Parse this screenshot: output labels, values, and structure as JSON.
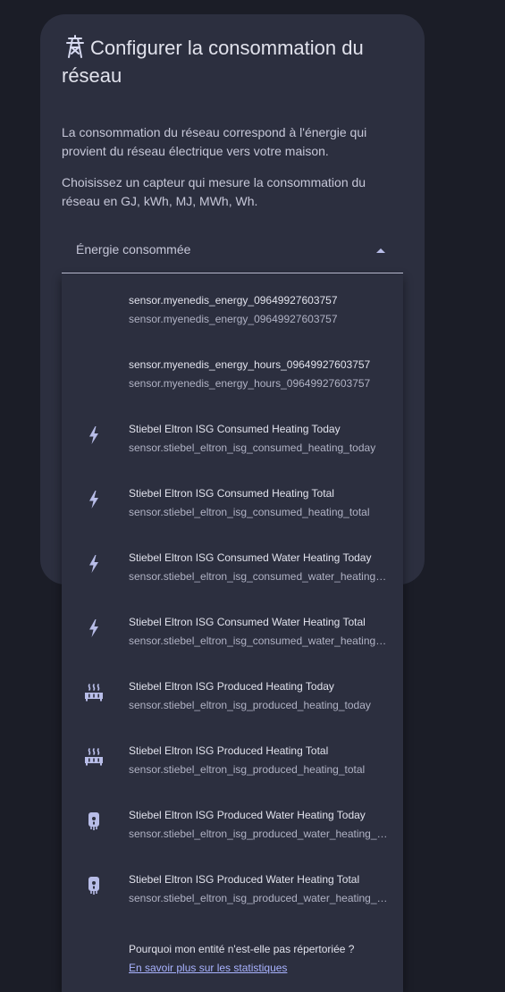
{
  "dialog": {
    "title": "Configurer la consommation du réseau",
    "title_icon": "transmission-tower-import-icon",
    "description_1": "La consommation du réseau correspond à l'énergie qui provient du réseau électrique vers votre maison.",
    "description_2": "Choisissez un capteur qui mesure la consommation du réseau en GJ, kWh, MJ, MWh, Wh."
  },
  "select": {
    "label": "Énergie consommée",
    "expanded": true
  },
  "menu": {
    "items": [
      {
        "name": "sensor.myenedis_energy_09649927603757",
        "entity_id": "sensor.myenedis_energy_09649927603757",
        "icon": "none"
      },
      {
        "name": "sensor.myenedis_energy_hours_09649927603757",
        "entity_id": "sensor.myenedis_energy_hours_09649927603757",
        "icon": "none"
      },
      {
        "name": "Stiebel Eltron ISG Consumed Heating Today",
        "entity_id": "sensor.stiebel_eltron_isg_consumed_heating_today",
        "icon": "lightning-bolt-icon"
      },
      {
        "name": "Stiebel Eltron ISG Consumed Heating Total",
        "entity_id": "sensor.stiebel_eltron_isg_consumed_heating_total",
        "icon": "lightning-bolt-icon"
      },
      {
        "name": "Stiebel Eltron ISG Consumed Water Heating Today",
        "entity_id": "sensor.stiebel_eltron_isg_consumed_water_heating_today",
        "icon": "lightning-bolt-icon"
      },
      {
        "name": "Stiebel Eltron ISG Consumed Water Heating Total",
        "entity_id": "sensor.stiebel_eltron_isg_consumed_water_heating_total",
        "icon": "lightning-bolt-icon"
      },
      {
        "name": "Stiebel Eltron ISG Produced Heating Today",
        "entity_id": "sensor.stiebel_eltron_isg_produced_heating_today",
        "icon": "radiator-icon"
      },
      {
        "name": "Stiebel Eltron ISG Produced Heating Total",
        "entity_id": "sensor.stiebel_eltron_isg_produced_heating_total",
        "icon": "radiator-icon"
      },
      {
        "name": "Stiebel Eltron ISG Produced Water Heating Today",
        "entity_id": "sensor.stiebel_eltron_isg_produced_water_heating_today",
        "icon": "water-boiler-icon"
      },
      {
        "name": "Stiebel Eltron ISG Produced Water Heating Total",
        "entity_id": "sensor.stiebel_eltron_isg_produced_water_heating_total",
        "icon": "water-boiler-icon"
      }
    ],
    "footer_question": "Pourquoi mon entité n'est-elle pas répertoriée ?",
    "footer_link": "En savoir plus sur les statistiques"
  },
  "colors": {
    "background": "#1b1d27",
    "surface": "#2c2f3f",
    "icon": "#b8bde8",
    "link": "#a9b3ff"
  }
}
